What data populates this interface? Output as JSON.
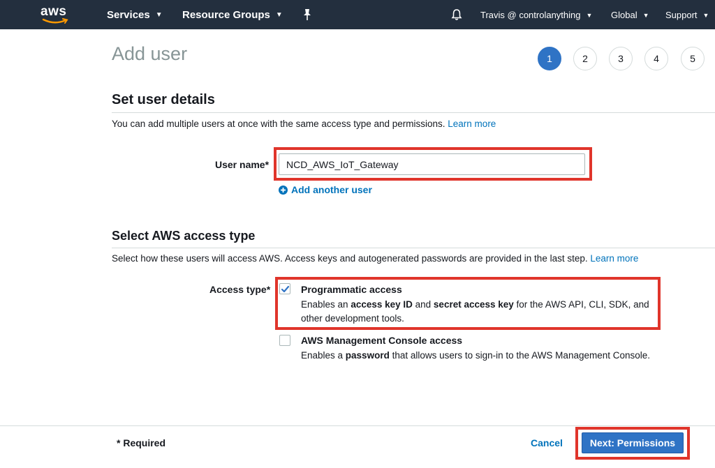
{
  "header": {
    "logo_text": "aws",
    "services_label": "Services",
    "resource_groups_label": "Resource Groups",
    "user_label": "Travis @ controlanything",
    "region_label": "Global",
    "support_label": "Support",
    "icons": [
      "pin-icon",
      "bell-icon",
      "chevron-down-icon"
    ]
  },
  "page": {
    "title": "Add user",
    "steps": [
      "1",
      "2",
      "3",
      "4",
      "5"
    ],
    "active_step": "1"
  },
  "user_details": {
    "title": "Set user details",
    "description": "You can add multiple users at once with the same access type and permissions.",
    "learn_more": "Learn more",
    "user_name_label": "User name*",
    "user_name_value": "NCD_AWS_IoT_Gateway",
    "add_another_user": "Add another user"
  },
  "access_type": {
    "title": "Select AWS access type",
    "description": "Select how these users will access AWS. Access keys and autogenerated passwords are provided in the last step.",
    "learn_more": "Learn more",
    "label": "Access type*",
    "options": [
      {
        "title": "Programmatic access",
        "checked": true,
        "desc_pre": "Enables an ",
        "desc_b1": "access key ID",
        "desc_mid": " and ",
        "desc_b2": "secret access key",
        "desc_post": " for the AWS API, CLI, SDK, and other development tools."
      },
      {
        "title": "AWS Management Console access",
        "checked": false,
        "desc_pre": "Enables a ",
        "desc_b1": "password",
        "desc_post": " that allows users to sign-in to the AWS Management Console."
      }
    ]
  },
  "footer": {
    "required_note": "* Required",
    "cancel_label": "Cancel",
    "next_label": "Next: Permissions"
  },
  "colors": {
    "topbar": "#232f3e",
    "primary": "#2f73c5",
    "link": "#0073bb",
    "highlight": "#e0352b"
  }
}
